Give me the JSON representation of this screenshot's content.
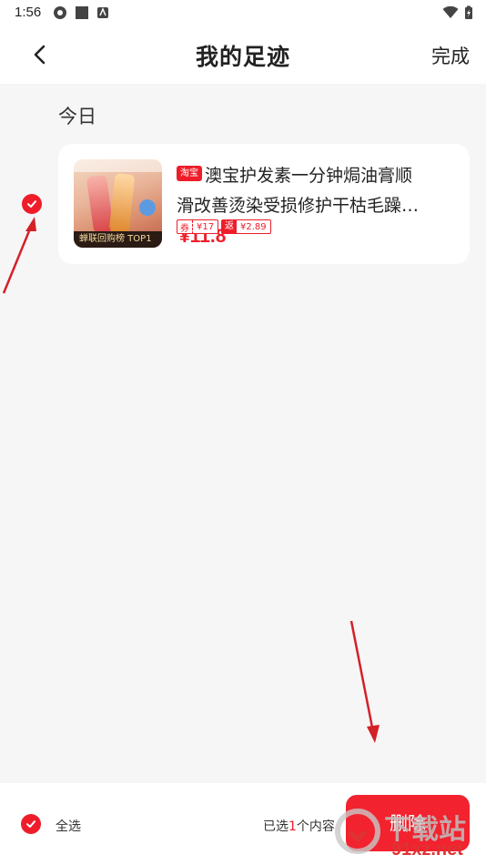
{
  "status_bar": {
    "time": "1:56"
  },
  "header": {
    "title": "我的足迹",
    "done_label": "完成"
  },
  "section": {
    "date_label": "今日"
  },
  "item": {
    "checked": true,
    "platform_tag": "淘宝",
    "title_line1": "澳宝护发素一分钟焗油膏顺",
    "title_line2": "滑改善烫染受损修护干枯毛躁…",
    "price": "¥11.8",
    "coupon_key": "券",
    "coupon_value": "¥17",
    "rebate_key": "返",
    "rebate_value": "¥2.89",
    "thumb_banner": "蝉联回购榜 TOP1"
  },
  "footer": {
    "select_all_label": "全选",
    "selected_prefix": "已选",
    "selected_count": "1",
    "selected_suffix": "个内容",
    "delete_label": "删除"
  },
  "watermark": {
    "text_big": "下载站",
    "text_small": "91xz.net"
  },
  "colors": {
    "accent": "#ef1d2a",
    "arrow": "#d42027"
  }
}
